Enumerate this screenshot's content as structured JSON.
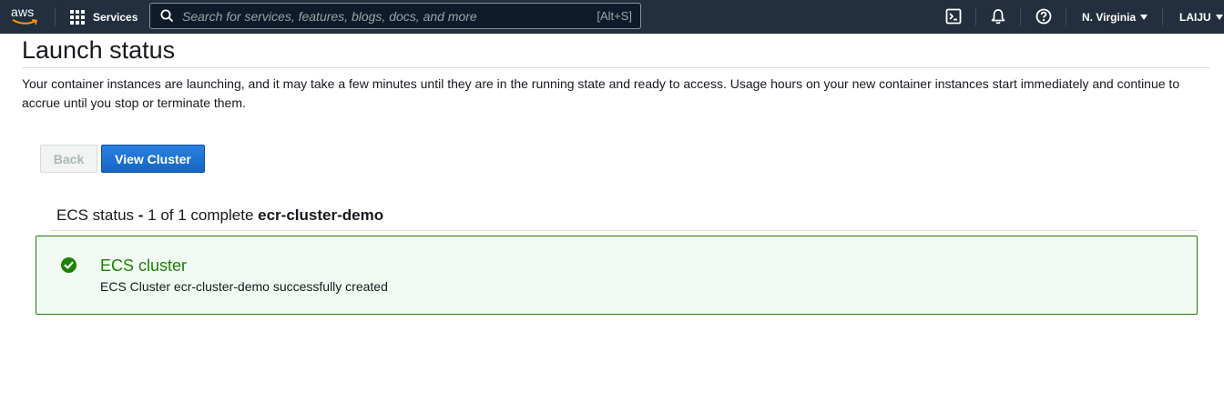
{
  "topnav": {
    "logo_text": "aws",
    "services_label": "Services",
    "search": {
      "placeholder": "Search for services, features, blogs, docs, and more",
      "shortcut": "[Alt+S]"
    },
    "icons": [
      "cloudshell-icon",
      "bell-icon",
      "help-icon"
    ],
    "region": "N. Virginia",
    "account": "LAIJU"
  },
  "page": {
    "title": "Launch status",
    "description": "Your container instances are launching, and it may take a few minutes until they are in the running state and ready to access. Usage hours on your new container instances start immediately and continue to accrue until you stop or terminate them."
  },
  "buttons": {
    "back": "Back",
    "view_cluster": "View Cluster"
  },
  "status": {
    "label": "ECS status",
    "separator": " - ",
    "progress": "1 of 1 complete",
    "cluster_name": "ecr-cluster-demo"
  },
  "result": {
    "title": "ECS cluster",
    "message": "ECS Cluster ecr-cluster-demo successfully created"
  },
  "colors": {
    "nav_background": "#232f3e",
    "accent_orange": "#ff9900",
    "primary_button": "#1b6fd1",
    "success_green": "#1d8102",
    "success_background": "#f2fbf3"
  }
}
